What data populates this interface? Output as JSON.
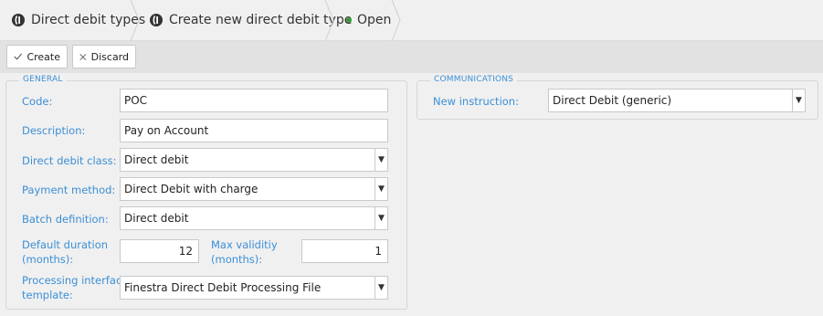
{
  "breadcrumb": {
    "items": [
      {
        "label": "Direct debit types",
        "icon": "brand-logo-icon"
      },
      {
        "label": "Create new direct debit type",
        "icon": "brand-logo-icon"
      },
      {
        "label": "Open",
        "icon": "status-dot-icon",
        "status_color": "#3a9a3a"
      }
    ]
  },
  "toolbar": {
    "create_label": "Create",
    "discard_label": "Discard"
  },
  "general": {
    "legend": "GENERAL",
    "code": {
      "label": "Code:",
      "value": "POC"
    },
    "description": {
      "label": "Description:",
      "value": "Pay on Account"
    },
    "direct_debit_class": {
      "label": "Direct debit class:",
      "value": "Direct debit"
    },
    "payment_method": {
      "label": "Payment method:",
      "value": "Direct Debit with charge"
    },
    "batch_definition": {
      "label": "Batch definition:",
      "value": "Direct debit"
    },
    "default_duration": {
      "label_line1": "Default duration",
      "label_line2": "(months):",
      "value": "12"
    },
    "max_validity": {
      "label_line1": "Max validitiy",
      "label_line2": "(months):",
      "value": "1"
    },
    "processing_template": {
      "label_line1": "Processing interface",
      "label_line2": "template:",
      "value": "Finestra Direct Debit Processing File"
    }
  },
  "communications": {
    "legend": "COMMUNICATIONS",
    "new_instruction": {
      "label": "New instruction:",
      "value": "Direct Debit (generic)"
    }
  },
  "colors": {
    "label_blue": "#3b8fd6",
    "status_green": "#3a9a3a"
  }
}
